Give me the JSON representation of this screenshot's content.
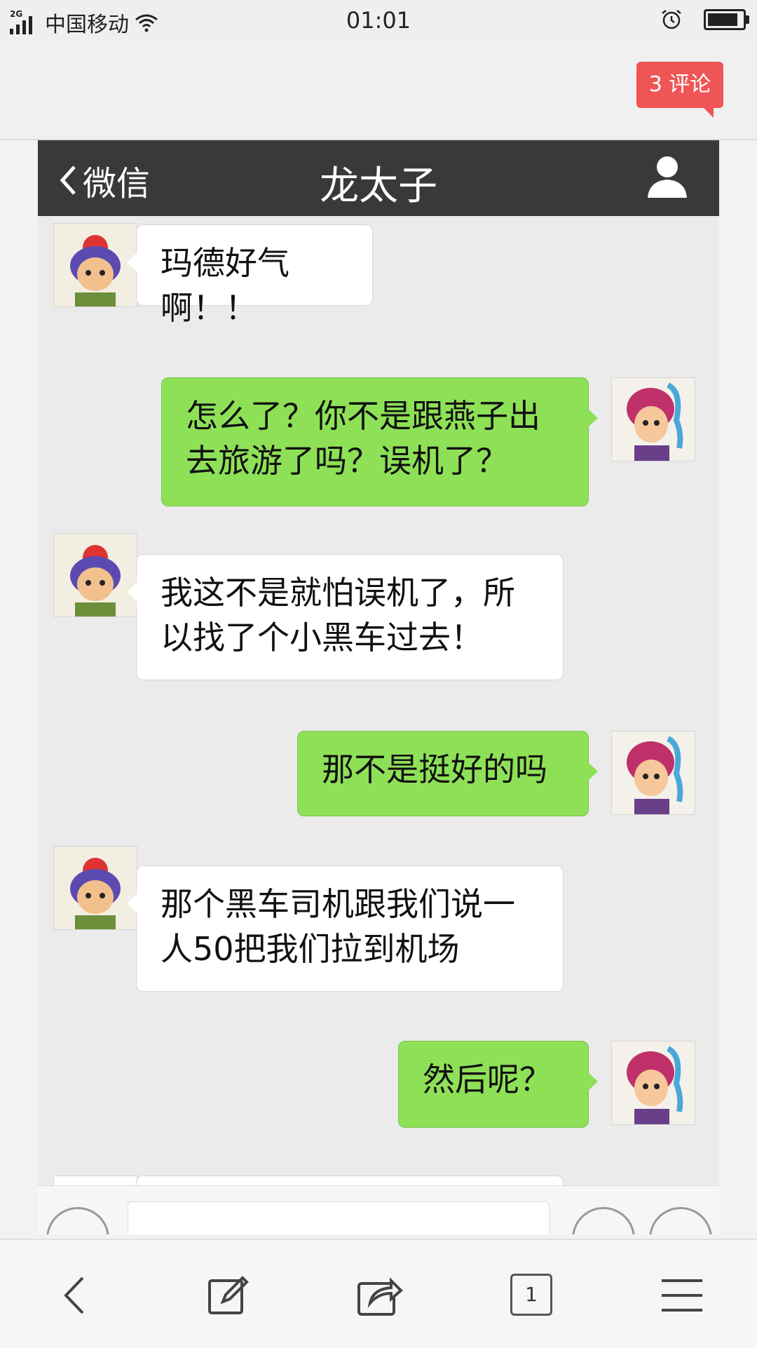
{
  "status_bar": {
    "network": "2G",
    "carrier": "中国移动",
    "time": "01:01",
    "battery_level": 0.95
  },
  "header": {
    "comment_badge": "3 评论"
  },
  "chat": {
    "back_label": "微信",
    "contact_name": "龙太子",
    "messages": [
      {
        "side": "left",
        "text": "玛德好气啊！！"
      },
      {
        "side": "right",
        "text": "怎么了？你不是跟燕子出\n去旅游了吗？误机了？"
      },
      {
        "side": "left",
        "text": "我这不是就怕误机了，所\n以找了个小黑车过去！"
      },
      {
        "side": "right",
        "text": "那不是挺好的吗"
      },
      {
        "side": "left",
        "text": "那个黑车司机跟我们说一\n人50把我们拉到机场"
      },
      {
        "side": "right",
        "text": "然后呢？"
      }
    ]
  },
  "toolbar": {
    "tab_count": "1"
  },
  "colors": {
    "wechat_nav": "#39393b",
    "bubble_green": "#8ee157",
    "badge_red": "#ef5555"
  },
  "icons": [
    "back-icon",
    "edit-icon",
    "share-icon",
    "tabs-icon",
    "menu-icon",
    "user-icon",
    "alarm-icon",
    "wifi-icon",
    "battery-icon"
  ]
}
